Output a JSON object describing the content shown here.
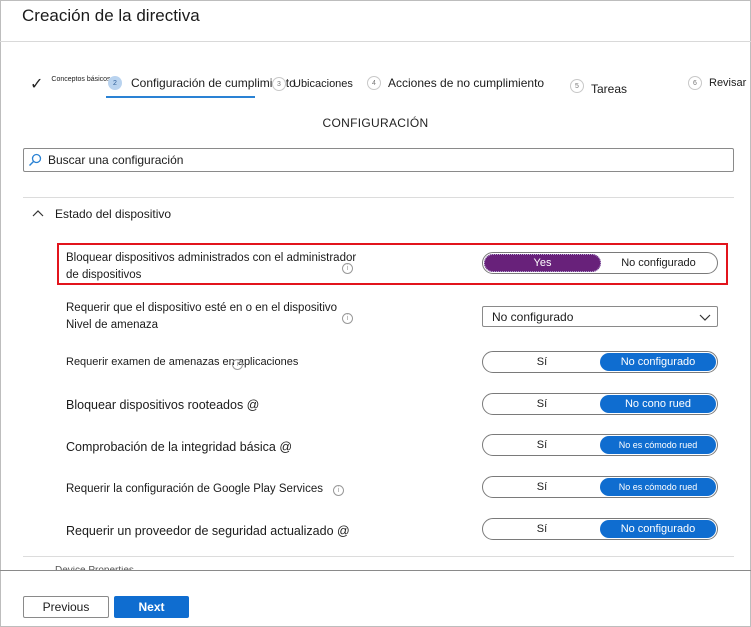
{
  "header": {
    "title": "Creación de la directiva"
  },
  "wizard": {
    "steps": [
      {
        "number": "",
        "label": "Conceptos básicos",
        "state": "completed"
      },
      {
        "number": "2",
        "label": "Configuración de cumplimiento",
        "state": "active"
      },
      {
        "number": "3",
        "label": "Ubicaciones",
        "state": "pending"
      },
      {
        "number": "4",
        "label": "Acciones de no cumplimiento",
        "state": "pending"
      },
      {
        "number": "5",
        "label": "Tareas",
        "state": "pending"
      },
      {
        "number": "6",
        "label": "Revisar",
        "state": "pending"
      }
    ]
  },
  "main": {
    "section_title": "CONFIGURACIÓN",
    "search": {
      "placeholder": "Buscar una configuración"
    },
    "group": {
      "label": "Estado del dispositivo",
      "expanded": true,
      "settings": [
        {
          "label_line1": "Bloquear dispositivos administrados con el administrador",
          "label_line2": "de dispositivos",
          "control": "toggle",
          "option_a": "Yes",
          "option_b": "No configurado",
          "selected": "a",
          "highlighted": true
        },
        {
          "label_line1": "Requerir que el dispositivo esté en o en el dispositivo",
          "label_line2": "Nivel de amenaza",
          "control": "select",
          "value": "No configurado"
        },
        {
          "label_line1": "Requerir examen de amenazas en aplicaciones",
          "control": "toggle",
          "option_a": "Sí",
          "option_b": "No configurado",
          "selected": "b"
        },
        {
          "label_line1": "Bloquear dispositivos rooteados @",
          "control": "toggle",
          "option_a": "Sí",
          "option_b": "No cono rued",
          "selected": "b"
        },
        {
          "label_line1": "Comprobación de la integridad básica @",
          "control": "toggle",
          "option_a": "Sí",
          "option_b": "No es cómodo rued",
          "selected": "b"
        },
        {
          "label_line1": "Requerir la configuración de Google Play Services",
          "control": "toggle",
          "option_a": "Sí",
          "option_b": "No es cómodo rued",
          "selected": "b"
        },
        {
          "label_line1": "Requerir un proveedor de seguridad actualizado @",
          "control": "toggle",
          "option_a": "Sí",
          "option_b": "No configurado",
          "selected": "b"
        }
      ]
    },
    "next_group_partial": "Device Properties"
  },
  "footer": {
    "previous_label": "Previous",
    "next_label": "Next"
  },
  "colors": {
    "accent": "#0f6dd0",
    "selected_purple": "#68217a",
    "highlight_border": "#e2141c",
    "underline": "#2a82d4"
  }
}
